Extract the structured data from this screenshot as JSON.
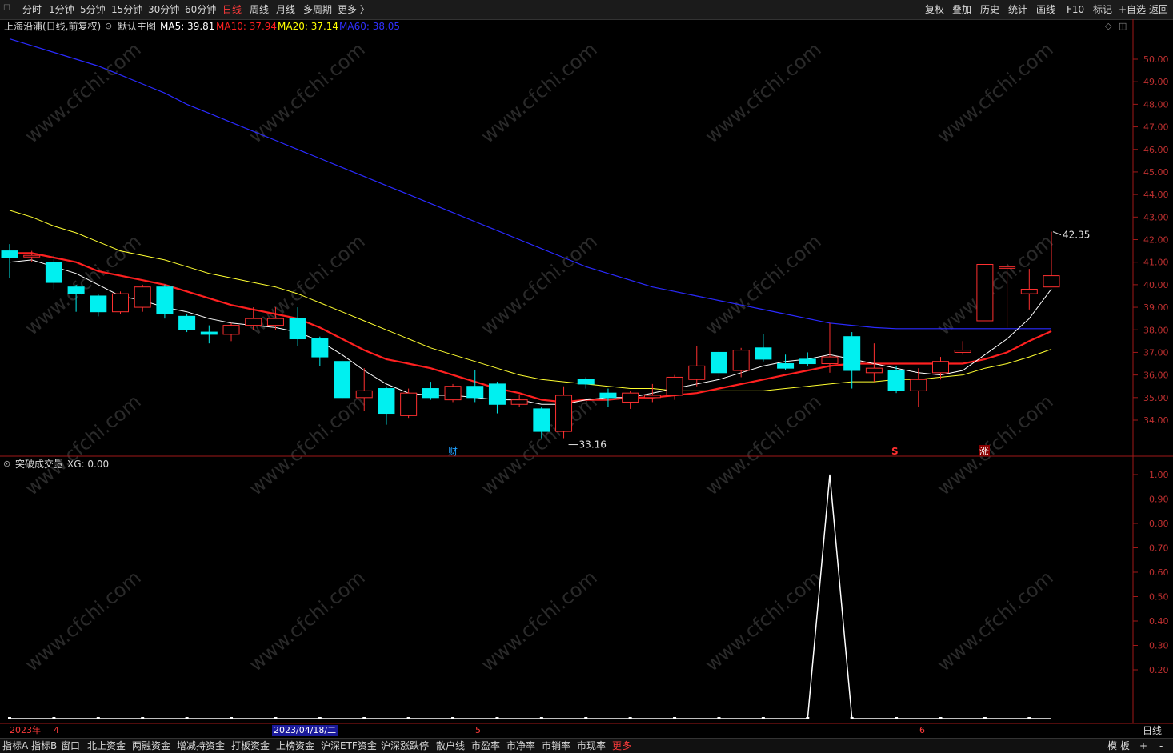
{
  "toolbar": {
    "periods": [
      "分时",
      "1分钟",
      "5分钟",
      "15分钟",
      "30分钟",
      "60分钟",
      "日线",
      "周线",
      "月线",
      "多周期",
      "更多 〉"
    ],
    "active_period": "日线",
    "right_buttons": [
      "复权",
      "叠加",
      "历史",
      "统计",
      "画线",
      "F10",
      "标记",
      "+自选",
      "返回"
    ]
  },
  "main_info": {
    "stock_title": "上海沿浦(日线,前复权)",
    "template_label": "默认主图",
    "ma5": "MA5: 39.81",
    "ma10": "MA10: 37.94",
    "ma20": "MA20: 37.14",
    "ma60": "MA60: 38.05",
    "colors": {
      "ma5": "#ffffff",
      "ma10": "#ff2020",
      "ma20": "#ffff00",
      "ma60": "#2020ff"
    }
  },
  "sub_info": {
    "indicator_label": "突破成交量",
    "xg": "XG: 0.00"
  },
  "annotations": {
    "high_label": "42.35",
    "low_label": "33.16",
    "marker_cai": "财",
    "marker_s": "S",
    "marker_zhang": "涨"
  },
  "x_axis": {
    "year_label": "2023年",
    "month_4": "4",
    "cursor_date": "2023/04/18/二",
    "month_5": "5",
    "month_6": "6",
    "period_label": "日线"
  },
  "bottom_tabs": [
    "指标A",
    "指标B",
    "窗口",
    "北上资金",
    "两融资金",
    "增减持资金",
    "打板资金",
    "上榜资金",
    "沪深ETF资金",
    "沪深涨跌停",
    "散户线",
    "市盈率",
    "市净率",
    "市销率",
    "市现率",
    "更多"
  ],
  "bottom_right": [
    "模 板",
    "+",
    "-"
  ],
  "chart_data": [
    {
      "type": "candlestick",
      "title": "上海沿浦(日线,前复权)",
      "ylim": [
        33.2,
        51.0
      ],
      "y_ticks": [
        "34.00",
        "35.00",
        "36.00",
        "37.00",
        "38.00",
        "39.00",
        "40.00",
        "41.00",
        "42.00",
        "43.00",
        "44.00",
        "45.00",
        "46.00",
        "47.00",
        "48.00",
        "49.00",
        "50.00"
      ],
      "candles": [
        {
          "o": 41.5,
          "c": 41.2,
          "h": 41.8,
          "l": 40.3
        },
        {
          "o": 41.3,
          "c": 41.3,
          "h": 41.5,
          "l": 41.0
        },
        {
          "o": 41.0,
          "c": 40.1,
          "h": 41.3,
          "l": 39.8
        },
        {
          "o": 39.9,
          "c": 39.6,
          "h": 40.0,
          "l": 38.8
        },
        {
          "o": 39.5,
          "c": 38.8,
          "h": 39.6,
          "l": 38.6
        },
        {
          "o": 38.8,
          "c": 39.6,
          "h": 39.7,
          "l": 38.7
        },
        {
          "o": 39.0,
          "c": 39.9,
          "h": 40.0,
          "l": 38.8
        },
        {
          "o": 39.9,
          "c": 38.7,
          "h": 40.0,
          "l": 38.5
        },
        {
          "o": 38.6,
          "c": 38.0,
          "h": 38.7,
          "l": 37.9
        },
        {
          "o": 37.9,
          "c": 37.8,
          "h": 38.2,
          "l": 37.4
        },
        {
          "o": 37.8,
          "c": 38.2,
          "h": 38.3,
          "l": 37.5
        },
        {
          "o": 38.2,
          "c": 38.5,
          "h": 39.0,
          "l": 38.0
        },
        {
          "o": 38.2,
          "c": 38.5,
          "h": 39.0,
          "l": 38.0
        },
        {
          "o": 38.5,
          "c": 37.6,
          "h": 39.0,
          "l": 37.3
        },
        {
          "o": 37.6,
          "c": 36.8,
          "h": 37.7,
          "l": 36.4
        },
        {
          "o": 36.6,
          "c": 35.0,
          "h": 36.7,
          "l": 34.9
        },
        {
          "o": 35.0,
          "c": 35.3,
          "h": 36.3,
          "l": 34.4
        },
        {
          "o": 35.4,
          "c": 34.3,
          "h": 35.5,
          "l": 33.8
        },
        {
          "o": 34.2,
          "c": 35.2,
          "h": 35.4,
          "l": 34.1
        },
        {
          "o": 35.4,
          "c": 35.0,
          "h": 35.7,
          "l": 34.9
        },
        {
          "o": 34.9,
          "c": 35.5,
          "h": 35.6,
          "l": 34.8
        },
        {
          "o": 35.5,
          "c": 35.0,
          "h": 36.2,
          "l": 34.8
        },
        {
          "o": 35.6,
          "c": 34.7,
          "h": 35.7,
          "l": 34.3
        },
        {
          "o": 34.7,
          "c": 34.9,
          "h": 35.1,
          "l": 34.6
        },
        {
          "o": 34.5,
          "c": 33.5,
          "h": 34.6,
          "l": 33.2
        },
        {
          "o": 33.5,
          "c": 35.1,
          "h": 35.5,
          "l": 33.2
        },
        {
          "o": 35.8,
          "c": 35.6,
          "h": 35.9,
          "l": 35.4
        },
        {
          "o": 35.2,
          "c": 35.0,
          "h": 35.4,
          "l": 34.6
        },
        {
          "o": 34.8,
          "c": 35.2,
          "h": 35.3,
          "l": 34.5
        },
        {
          "o": 35.0,
          "c": 35.1,
          "h": 35.6,
          "l": 34.8
        },
        {
          "o": 35.1,
          "c": 35.9,
          "h": 36.0,
          "l": 34.9
        },
        {
          "o": 35.8,
          "c": 36.4,
          "h": 37.3,
          "l": 35.5
        },
        {
          "o": 37.0,
          "c": 36.1,
          "h": 37.1,
          "l": 35.9
        },
        {
          "o": 36.2,
          "c": 37.1,
          "h": 37.2,
          "l": 35.9
        },
        {
          "o": 37.2,
          "c": 36.7,
          "h": 37.8,
          "l": 36.6
        },
        {
          "o": 36.5,
          "c": 36.3,
          "h": 36.9,
          "l": 36.2
        },
        {
          "o": 36.7,
          "c": 36.5,
          "h": 37.0,
          "l": 36.4
        },
        {
          "o": 36.5,
          "c": 36.8,
          "h": 38.3,
          "l": 36.1
        },
        {
          "o": 37.7,
          "c": 36.2,
          "h": 37.9,
          "l": 35.4
        },
        {
          "o": 36.1,
          "c": 36.3,
          "h": 37.4,
          "l": 35.7
        },
        {
          "o": 36.2,
          "c": 35.3,
          "h": 36.4,
          "l": 35.2
        },
        {
          "o": 35.3,
          "c": 35.8,
          "h": 36.3,
          "l": 34.6
        },
        {
          "o": 36.1,
          "c": 36.6,
          "h": 36.8,
          "l": 35.8
        },
        {
          "o": 37.0,
          "c": 37.1,
          "h": 37.5,
          "l": 36.9
        },
        {
          "o": 38.4,
          "c": 40.9,
          "h": 40.9,
          "l": 38.4
        },
        {
          "o": 40.8,
          "c": 40.8,
          "h": 40.9,
          "l": 38.1
        },
        {
          "o": 39.6,
          "c": 39.8,
          "h": 40.7,
          "l": 38.9
        },
        {
          "o": 39.9,
          "c": 40.4,
          "h": 42.35,
          "l": 39.9
        }
      ],
      "ma5": [
        41.0,
        41.1,
        40.8,
        40.5,
        40.0,
        39.5,
        39.3,
        39.0,
        38.8,
        38.5,
        38.3,
        38.2,
        38.1,
        37.9,
        37.5,
        36.9,
        36.2,
        35.6,
        35.2,
        35.1,
        35.1,
        35.0,
        34.9,
        34.9,
        34.7,
        34.7,
        34.9,
        35.0,
        35.0,
        35.2,
        35.4,
        35.6,
        35.8,
        36.1,
        36.4,
        36.6,
        36.7,
        36.9,
        36.7,
        36.5,
        36.3,
        36.1,
        36.0,
        36.2,
        36.9,
        37.6,
        38.5,
        39.81
      ],
      "ma10": [
        41.4,
        41.4,
        41.2,
        41.0,
        40.6,
        40.4,
        40.2,
        40.0,
        39.7,
        39.4,
        39.1,
        38.9,
        38.7,
        38.5,
        38.1,
        37.6,
        37.1,
        36.7,
        36.5,
        36.3,
        36.0,
        35.7,
        35.4,
        35.2,
        34.9,
        34.8,
        34.9,
        34.9,
        35.0,
        35.0,
        35.1,
        35.2,
        35.4,
        35.6,
        35.8,
        36.0,
        36.2,
        36.4,
        36.5,
        36.5,
        36.5,
        36.5,
        36.5,
        36.5,
        36.7,
        37.0,
        37.5,
        37.94
      ],
      "ma20": [
        43.3,
        43.0,
        42.6,
        42.3,
        41.9,
        41.5,
        41.3,
        41.1,
        40.8,
        40.5,
        40.3,
        40.1,
        39.9,
        39.6,
        39.2,
        38.8,
        38.4,
        38.0,
        37.6,
        37.2,
        36.9,
        36.6,
        36.3,
        36.0,
        35.8,
        35.7,
        35.6,
        35.5,
        35.4,
        35.4,
        35.3,
        35.3,
        35.3,
        35.3,
        35.3,
        35.4,
        35.5,
        35.6,
        35.7,
        35.7,
        35.8,
        35.8,
        35.9,
        36.0,
        36.3,
        36.5,
        36.8,
        37.14
      ],
      "ma60": [
        50.9,
        50.6,
        50.3,
        50.0,
        49.7,
        49.3,
        48.9,
        48.5,
        48.0,
        47.6,
        47.2,
        46.8,
        46.4,
        46.0,
        45.6,
        45.2,
        44.8,
        44.4,
        44.0,
        43.6,
        43.2,
        42.8,
        42.4,
        42.0,
        41.6,
        41.2,
        40.8,
        40.5,
        40.2,
        39.9,
        39.7,
        39.5,
        39.3,
        39.1,
        38.9,
        38.7,
        38.5,
        38.3,
        38.2,
        38.1,
        38.05,
        38.05,
        38.05,
        38.05,
        38.05,
        38.05,
        38.05,
        38.05
      ]
    },
    {
      "type": "line",
      "title": "突破成交量",
      "ylim": [
        0,
        1.05
      ],
      "y_ticks": [
        "0.20",
        "0.30",
        "0.40",
        "0.50",
        "0.60",
        "0.70",
        "0.80",
        "0.90",
        "1.00"
      ],
      "values": [
        0,
        0,
        0,
        0,
        0,
        0,
        0,
        0,
        0,
        0,
        0,
        0,
        0,
        0,
        0,
        0,
        0,
        0,
        0,
        0,
        0,
        0,
        0,
        0,
        0,
        0,
        0,
        0,
        0,
        0,
        0,
        0,
        0,
        0,
        0,
        0,
        0,
        1,
        0,
        0,
        0,
        0,
        0,
        0,
        0,
        0,
        0,
        0
      ]
    }
  ]
}
